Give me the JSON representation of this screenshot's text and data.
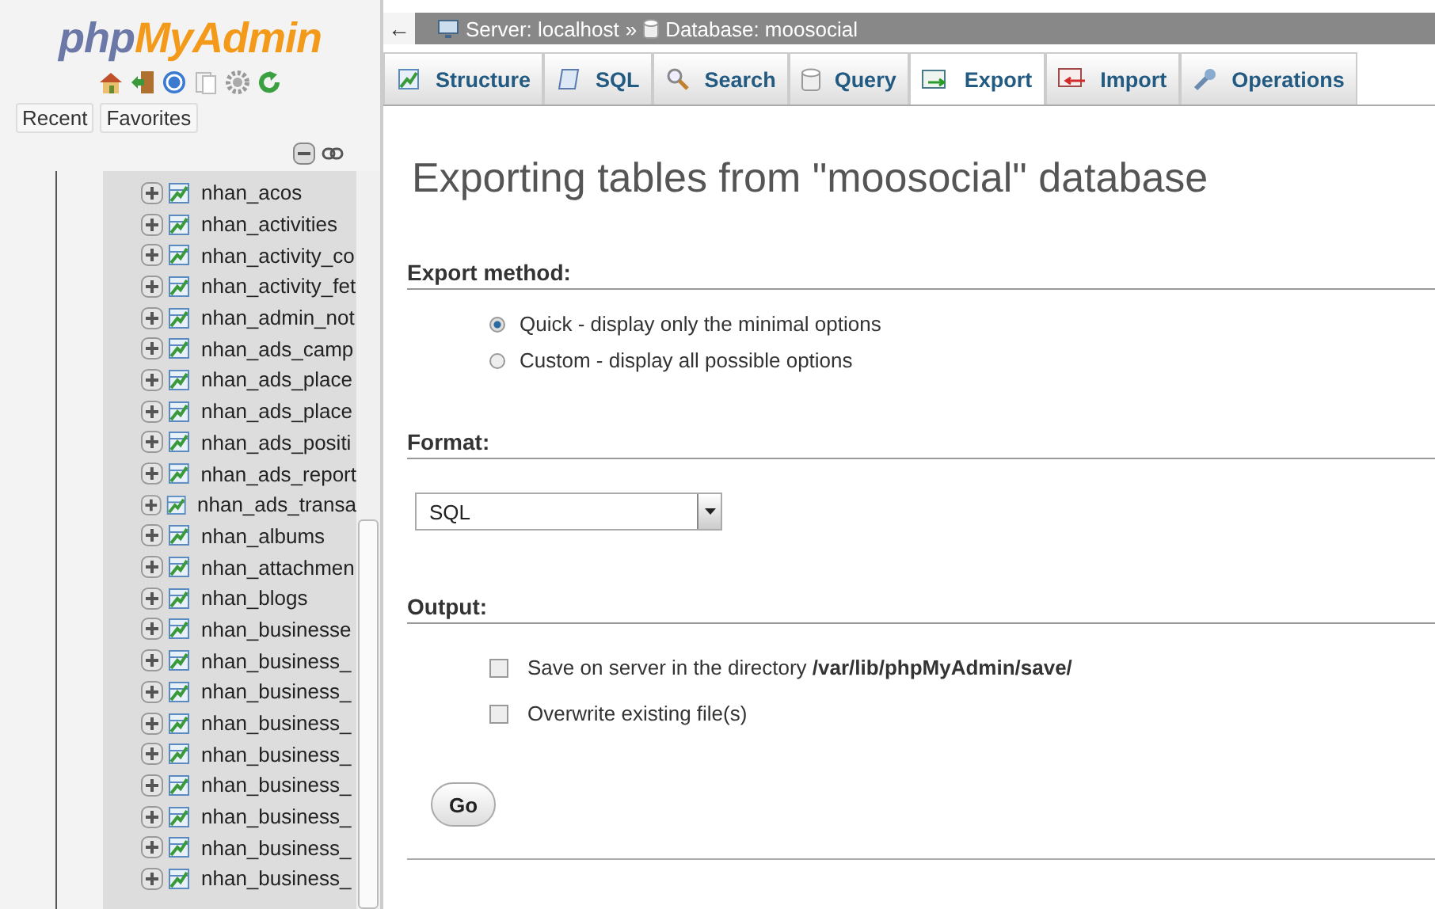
{
  "logo": {
    "part1": "php",
    "part2": "MyAdmin"
  },
  "nav_tabs": [
    {
      "label": "Recent",
      "selected": false
    },
    {
      "label": "Favorites",
      "selected": false
    }
  ],
  "tree": {
    "items": [
      {
        "name": "nhan_acos"
      },
      {
        "name": "nhan_activities"
      },
      {
        "name": "nhan_activity_co"
      },
      {
        "name": "nhan_activity_fet"
      },
      {
        "name": "nhan_admin_not"
      },
      {
        "name": "nhan_ads_camp"
      },
      {
        "name": "nhan_ads_place"
      },
      {
        "name": "nhan_ads_place"
      },
      {
        "name": "nhan_ads_positi"
      },
      {
        "name": "nhan_ads_report"
      },
      {
        "name": "nhan_ads_transa"
      },
      {
        "name": "nhan_albums"
      },
      {
        "name": "nhan_attachmen"
      },
      {
        "name": "nhan_blogs"
      },
      {
        "name": "nhan_businesse"
      },
      {
        "name": "nhan_business_"
      },
      {
        "name": "nhan_business_"
      },
      {
        "name": "nhan_business_"
      },
      {
        "name": "nhan_business_"
      },
      {
        "name": "nhan_business_"
      },
      {
        "name": "nhan_business_"
      },
      {
        "name": "nhan_business_"
      },
      {
        "name": "nhan_business_"
      }
    ]
  },
  "breadcrumb": {
    "back": "←",
    "server": "Server: localhost",
    "separator": "»",
    "database": "Database: moosocial"
  },
  "tabs": [
    {
      "label": "Structure",
      "kind": "structure",
      "selected": false
    },
    {
      "label": "SQL",
      "kind": "sql",
      "selected": false
    },
    {
      "label": "Search",
      "kind": "search",
      "selected": false
    },
    {
      "label": "Query",
      "kind": "query",
      "selected": false
    },
    {
      "label": "Export",
      "kind": "export",
      "selected": true
    },
    {
      "label": "Import",
      "kind": "import",
      "selected": false
    },
    {
      "label": "Operations",
      "kind": "operations",
      "selected": false
    }
  ],
  "title": "Exporting tables from \"moosocial\" database",
  "export_method": {
    "heading": "Export method:",
    "options": [
      {
        "label": "Quick - display only the minimal options",
        "selected": true
      },
      {
        "label": "Custom - display all possible options",
        "selected": false
      }
    ]
  },
  "format": {
    "heading": "Format:",
    "value": "SQL"
  },
  "output": {
    "heading": "Output:",
    "options": [
      {
        "label": "Save on server in the directory **/var/lib/phpMyAdmin/save/**",
        "checked": false
      },
      {
        "label": "Overwrite existing file(s)",
        "checked": false
      }
    ]
  },
  "go_button": "Go"
}
